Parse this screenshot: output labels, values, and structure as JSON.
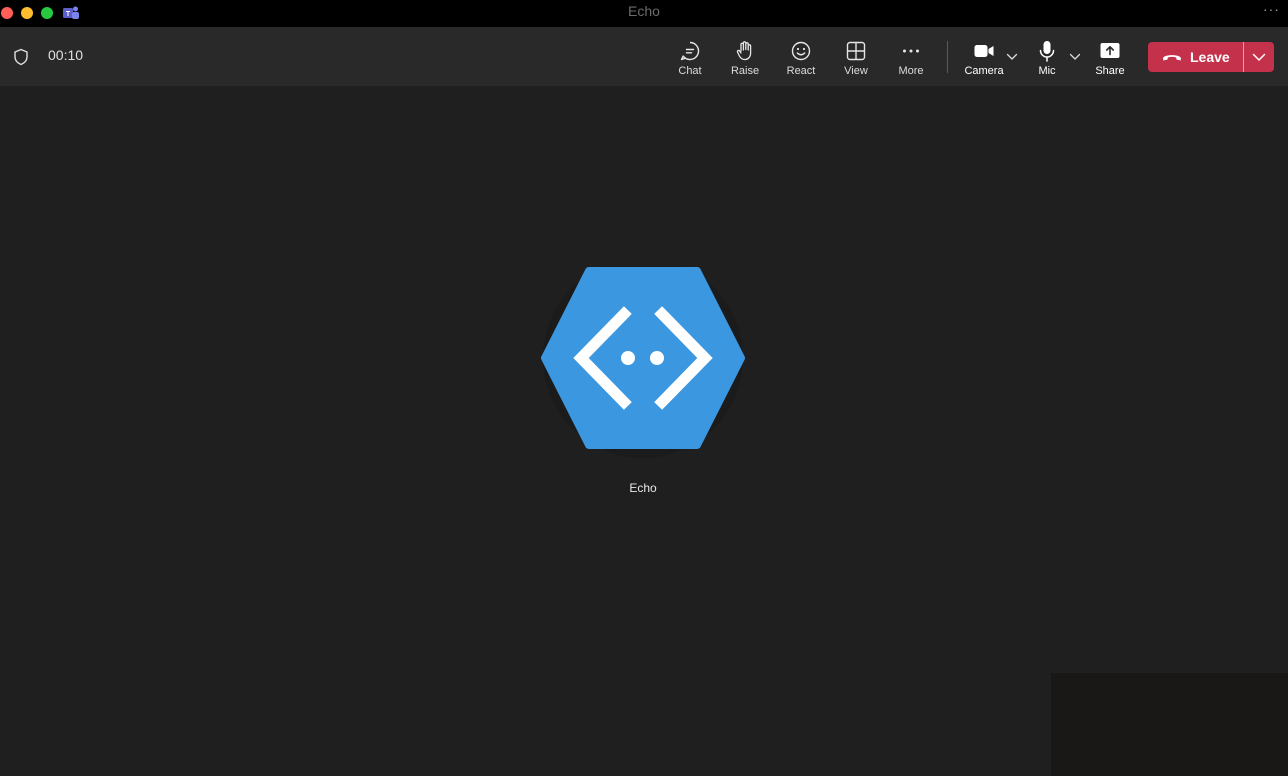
{
  "window": {
    "title": "Echo",
    "more_glyph": "···"
  },
  "meeting": {
    "timer": "00:10",
    "toolbar": {
      "chat": "Chat",
      "raise": "Raise",
      "react": "React",
      "view": "View",
      "more": "More",
      "camera": "Camera",
      "mic": "Mic",
      "share": "Share",
      "leave": "Leave"
    }
  },
  "participant": {
    "name": "Echo",
    "avatar_color": "#3b97e0"
  },
  "colors": {
    "leave_red": "#c4314b",
    "toolbar_bg": "#292929",
    "stage_bg": "#1f1f1f"
  },
  "icons": [
    "shield-icon",
    "chat-icon",
    "raise-hand-icon",
    "react-icon",
    "view-icon",
    "more-icon",
    "camera-icon",
    "mic-icon",
    "share-icon",
    "phone-hangup-icon",
    "chevron-down-icon"
  ]
}
